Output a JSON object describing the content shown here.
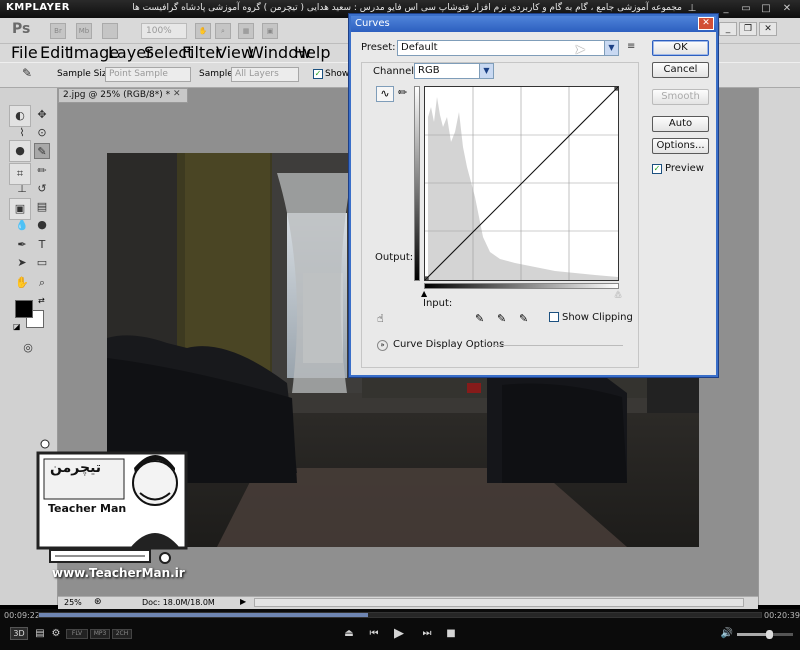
{
  "player": {
    "logo": "KMPLAYER",
    "caption": "مجموعه آموزشی جامع ، گام به گام و کاربردی نرم افزار فتوشاپ سی اس فایو   مدرس : سعید هدایی ( تیچرمن ) گروه آموزشی پادشاه گرافیست ها",
    "time_elapsed": "00:09:22",
    "time_total": "00:20:39",
    "progress": 0.455,
    "badges": [
      "3D",
      "FLV",
      "MP3",
      "2CH"
    ]
  },
  "photoshop": {
    "logo": "Ps",
    "app_icons": [
      "Br",
      "Mb"
    ],
    "zoom": "100%",
    "menu": [
      "File",
      "Edit",
      "Image",
      "Layer",
      "Select",
      "Filter",
      "View",
      "Window",
      "Help"
    ],
    "options": {
      "sample_size_label": "Sample Size:",
      "sample_size_value": "Point Sample",
      "sample_label": "Sample:",
      "sample_value": "All Layers",
      "show_label": "Show S"
    },
    "document": {
      "tab_label": "2.jpg @ 25% (RGB/8*) *",
      "zoom_status": "25%",
      "doc_status": "Doc: 18.0M/18.0M"
    }
  },
  "curves": {
    "title": "Curves",
    "preset_label": "Preset:",
    "preset_value": "Default",
    "channel_label": "Channel:",
    "channel_value": "RGB",
    "output_label": "Output:",
    "input_label": "Input:",
    "buttons": {
      "ok": "OK",
      "cancel": "Cancel",
      "smooth": "Smooth",
      "auto": "Auto",
      "options": "Options..."
    },
    "preview_label": "Preview",
    "preview_checked": true,
    "show_clipping_label": "Show Clipping",
    "show_clipping_checked": false,
    "display_options_label": "Curve Display Options"
  },
  "watermark": {
    "brand_fa": "تیچرمن",
    "brand_en": "Teacher Man",
    "url": "www.TeacherMan.ir"
  },
  "colors": {
    "dialog_accent": "#2d5fbf",
    "ps_panel": "#d9d9d9",
    "seek_fill": "#6f86b3"
  }
}
